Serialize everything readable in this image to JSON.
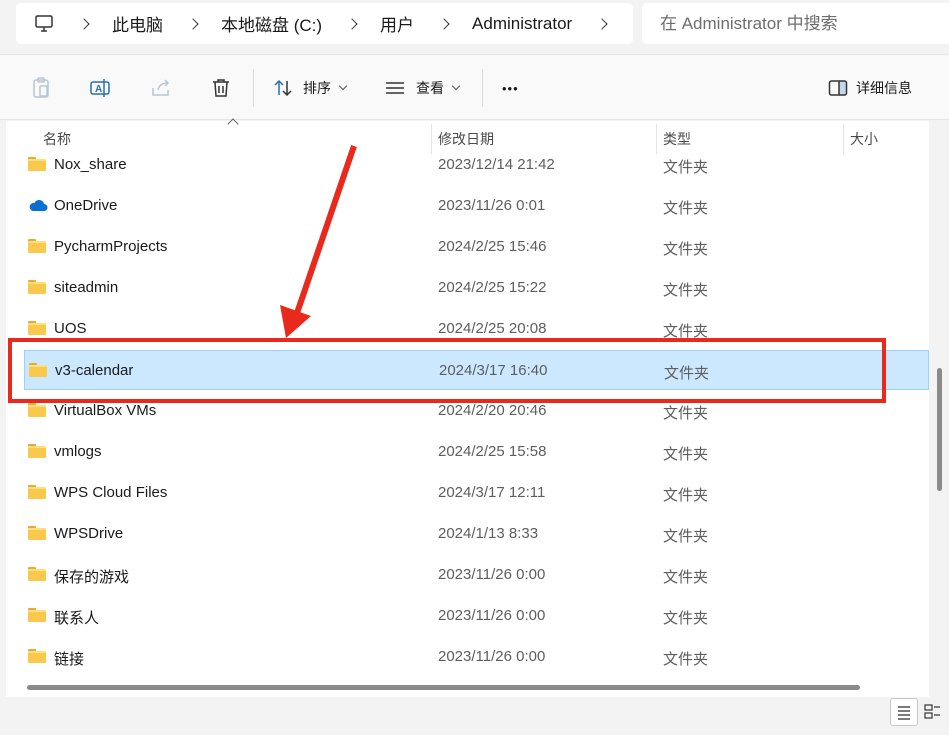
{
  "address_bar": {
    "crumbs": [
      "此电脑",
      "本地磁盘 (C:)",
      "用户",
      "Administrator"
    ]
  },
  "search": {
    "placeholder": "在 Administrator 中搜索"
  },
  "toolbar": {
    "sort_label": "排序",
    "view_label": "查看",
    "more_label": "•••",
    "details_label": "详细信息"
  },
  "columns": {
    "name": "名称",
    "date": "修改日期",
    "type": "类型",
    "size": "大小"
  },
  "files": [
    {
      "name": "Nox_share",
      "date": "2023/12/14 21:42",
      "type": "文件夹",
      "icon": "folder-icon"
    },
    {
      "name": "OneDrive",
      "date": "2023/11/26 0:01",
      "type": "文件夹",
      "icon": "cloud-icon"
    },
    {
      "name": "PycharmProjects",
      "date": "2024/2/25 15:46",
      "type": "文件夹",
      "icon": "folder-icon"
    },
    {
      "name": "siteadmin",
      "date": "2024/2/25 15:22",
      "type": "文件夹",
      "icon": "folder-icon"
    },
    {
      "name": "UOS",
      "date": "2024/2/25 20:08",
      "type": "文件夹",
      "icon": "folder-icon"
    },
    {
      "name": "v3-calendar",
      "date": "2024/3/17 16:40",
      "type": "文件夹",
      "icon": "folder-icon",
      "selected": true
    },
    {
      "name": "VirtualBox VMs",
      "date": "2024/2/20 20:46",
      "type": "文件夹",
      "icon": "folder-icon"
    },
    {
      "name": "vmlogs",
      "date": "2024/2/25 15:58",
      "type": "文件夹",
      "icon": "folder-icon"
    },
    {
      "name": "WPS Cloud Files",
      "date": "2024/3/17 12:11",
      "type": "文件夹",
      "icon": "folder-icon"
    },
    {
      "name": "WPSDrive",
      "date": "2024/1/13 8:33",
      "type": "文件夹",
      "icon": "folder-icon"
    },
    {
      "name": "保存的游戏",
      "date": "2023/11/26 0:00",
      "type": "文件夹",
      "icon": "folder-icon"
    },
    {
      "name": "联系人",
      "date": "2023/11/26 0:00",
      "type": "文件夹",
      "icon": "folder-icon"
    },
    {
      "name": "链接",
      "date": "2023/11/26 0:00",
      "type": "文件夹",
      "icon": "folder-icon"
    }
  ],
  "colors": {
    "selection": "#cce8ff",
    "annotation": "#e8291c",
    "folder": "#f8c94c",
    "onedrive": "#0a6fd1"
  }
}
